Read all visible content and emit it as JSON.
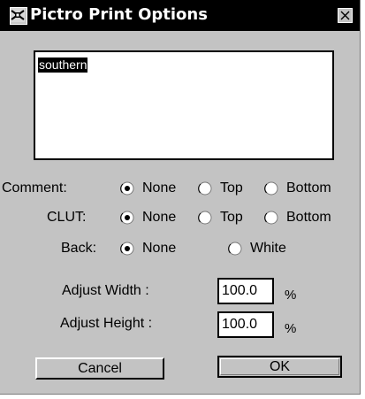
{
  "window": {
    "title": "Pictro Print Options",
    "icon": "pictro-app-icon",
    "close_icon": "close-x-icon"
  },
  "textbox": {
    "selected_text": "southern"
  },
  "options": {
    "comment": {
      "label": "Comment:",
      "choices": [
        "None",
        "Top",
        "Bottom"
      ],
      "selected": "None"
    },
    "clut": {
      "label": "CLUT:",
      "choices": [
        "None",
        "Top",
        "Bottom"
      ],
      "selected": "None"
    },
    "back": {
      "label": "Back:",
      "choices": [
        "None",
        "White"
      ],
      "selected": "None"
    }
  },
  "adjust": {
    "width_label": "Adjust  Width :",
    "width_value": "100.0",
    "height_label": "Adjust Height :",
    "height_value": "100.0",
    "unit": "%"
  },
  "buttons": {
    "cancel": "Cancel",
    "ok": "OK"
  },
  "colors": {
    "dialog_bg": "#c3c3c3",
    "titlebar_bg": "#000000",
    "title_text": "#ffffff"
  }
}
